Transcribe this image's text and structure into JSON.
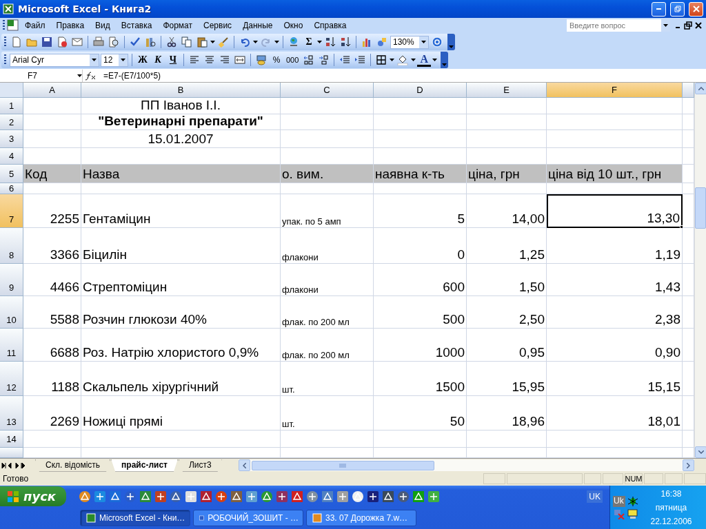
{
  "window": {
    "title": "Microsoft Excel - Книга2"
  },
  "menu": [
    "Файл",
    "Правка",
    "Вид",
    "Вставка",
    "Формат",
    "Сервис",
    "Данные",
    "Окно",
    "Справка"
  ],
  "help_box": {
    "placeholder": "Введите вопрос"
  },
  "standard_toolbar": {
    "sum_symbol": "Σ",
    "zoom": "130%"
  },
  "formatting_toolbar": {
    "font": "Arial Cyr",
    "size": "12",
    "bold": "Ж",
    "italic": "К",
    "underline": "Ч",
    "percent": "%",
    "thousands": "000",
    "font_color": "A"
  },
  "formula_bar": {
    "name_box": "F7",
    "formula": "=E7-(E7/100*5)"
  },
  "columns": [
    {
      "label": "A",
      "selected": false
    },
    {
      "label": "B",
      "selected": false
    },
    {
      "label": "C",
      "selected": false
    },
    {
      "label": "D",
      "selected": false
    },
    {
      "label": "E",
      "selected": false
    },
    {
      "label": "F",
      "selected": true
    }
  ],
  "rows": [
    {
      "label": "1",
      "kind": "caption",
      "selected": false,
      "cells": {
        "B": "ПП Іванов І.І."
      }
    },
    {
      "label": "2",
      "kind": "title",
      "selected": false,
      "cells": {
        "B": "\"Ветеринарні препарати\""
      }
    },
    {
      "label": "3",
      "kind": "caption",
      "selected": false,
      "cells": {
        "B": "15.01.2007"
      }
    },
    {
      "label": "4",
      "kind": "blank",
      "selected": false,
      "cells": {}
    },
    {
      "label": "5",
      "kind": "header",
      "selected": false,
      "cells": {
        "A": "Код",
        "B": "Назва",
        "C": "о. вим.",
        "D": "наявна к-ть",
        "E": "ціна, грн",
        "F": "ціна від 10 шт., грн"
      }
    },
    {
      "label": "6",
      "kind": "blank",
      "selected": false,
      "cells": {}
    },
    {
      "label": "7",
      "kind": "item",
      "selected": true,
      "cells": {
        "A": "2255",
        "B": "Гентаміцин",
        "C": "упак. по 5 амп",
        "D": "5",
        "E": "14,00",
        "F": "13,30"
      }
    },
    {
      "label": "8",
      "kind": "item",
      "selected": false,
      "cells": {
        "A": "3366",
        "B": "Біцилін",
        "C": "флакони",
        "D": "0",
        "E": "1,25",
        "F": "1,19"
      }
    },
    {
      "label": "9",
      "kind": "item",
      "selected": false,
      "cells": {
        "A": "4466",
        "B": "Стрептоміцин",
        "C": "флакони",
        "D": "600",
        "E": "1,50",
        "F": "1,43"
      }
    },
    {
      "label": "10",
      "kind": "item",
      "selected": false,
      "cells": {
        "A": "5588",
        "B": "Розчин глюкози 40%",
        "C": "флак. по 200 мл",
        "D": "500",
        "E": "2,50",
        "F": "2,38"
      }
    },
    {
      "label": "11",
      "kind": "item",
      "selected": false,
      "cells": {
        "A": "6688",
        "B": "Роз. Натрію хлористого 0,9%",
        "C": "флак. по 200 мл",
        "D": "1000",
        "E": "0,95",
        "F": "0,90"
      }
    },
    {
      "label": "12",
      "kind": "item",
      "selected": false,
      "cells": {
        "A": "1188",
        "B": "Скальпель хірургічний",
        "C": "шт.",
        "D": "1500",
        "E": "15,95",
        "F": "15,15"
      }
    },
    {
      "label": "13",
      "kind": "item",
      "selected": false,
      "cells": {
        "A": "2269",
        "B": "Ножиці прямі",
        "C": "шт.",
        "D": "50",
        "E": "18,96",
        "F": "18,01"
      }
    },
    {
      "label": "14",
      "kind": "blank",
      "selected": false,
      "cells": {}
    }
  ],
  "sheet_tabs": [
    {
      "label": "Скл. відомість",
      "selected": false
    },
    {
      "label": "прайс-лист",
      "selected": true
    },
    {
      "label": "Лист3",
      "selected": false
    }
  ],
  "status_bar": {
    "mode": "Готово",
    "num": "NUM"
  },
  "taskbar": {
    "start": "пуск",
    "language": "UK",
    "tray_language": "Uk",
    "time": "16:38",
    "day": "пятница",
    "date": "22.12.2006",
    "tasks": [
      {
        "label": "Microsoft Excel - Кни…",
        "selected": true
      },
      {
        "label": "РОБОЧИЙ_ЗОШИТ - …",
        "selected": false
      },
      {
        "label": "33. 07 Дорожка 7.w…",
        "selected": false
      }
    ]
  }
}
